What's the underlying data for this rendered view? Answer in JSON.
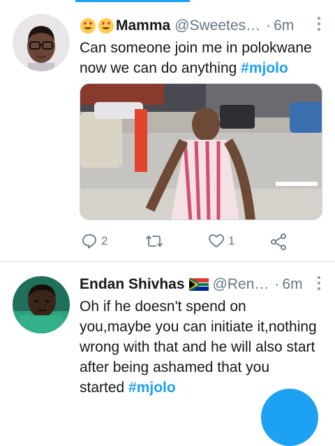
{
  "colors": {
    "accent": "#1da1f2",
    "muted": "#657786",
    "text": "#14171a",
    "divider": "#e6ecf0"
  },
  "tweets": [
    {
      "emoji_icons": [
        "smiling-face-with-heart-eyes-icon",
        "smiling-face-with-heart-eyes-icon"
      ],
      "name": "Mamma",
      "handle": "@Sweetes…",
      "separator": "·",
      "time": "6m",
      "text_plain": "Can someone join me in polokwane now we can do anything ",
      "hashtag": "#mjolo",
      "reply_count": "2",
      "retweet_count": "",
      "like_count": "1"
    },
    {
      "name": "Endan Shivhas",
      "flag_icon": "south-africa-flag-icon",
      "handle": "@Ren…",
      "separator": "·",
      "time": "6m",
      "text_plain": "Oh if he doesn't spend on you,maybe you can initiate it,nothing wrong with that and he will also start after being ashamed that you started ",
      "hashtag": "#mjolo"
    }
  ]
}
